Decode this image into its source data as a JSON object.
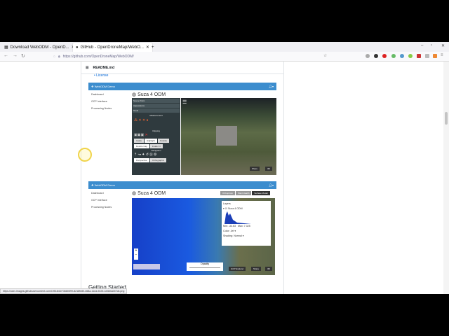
{
  "browser": {
    "tabs": [
      {
        "label": "Download WebODM - OpenD...",
        "active": false
      },
      {
        "label": "GitHub - OpenDroneMap/WebO...",
        "active": true
      }
    ],
    "new_tab": "+",
    "url": "https://github.com/OpenDroneMap/WebODM/",
    "status_url": "https://user-images.githubusercontent.com/1951843/73680599-8218fe80-468a-11ea-9225-443bba0b7c8.png"
  },
  "readme": {
    "file": "README.md",
    "license_link": "License",
    "heading": "Getting Started",
    "demo1": {
      "brand": "WebODM Demo",
      "title": "Suza 4 ODM",
      "sidebar": [
        "Dashboard",
        "GCP Interface",
        "Processing Nodes"
      ],
      "panel_sections": [
        "Measurement",
        "Clipping",
        "Navigation"
      ],
      "panel_rows": [
        "Scene Point",
        "Appearance",
        "Tools"
      ],
      "buttons": [
        "Inside",
        "Highlight",
        "Outside",
        "Double Cap",
        "Inside Cl",
        "Perspective",
        "Orthographic"
      ],
      "share": "Share",
      "view3d": "3D"
    },
    "demo2": {
      "brand": "WebODM Demo",
      "title": "Suza 4 ODM",
      "sidebar": [
        "Dashboard",
        "GCP Interface",
        "Processing Nodes"
      ],
      "actions": [
        "Orthophoto",
        "Plant Health",
        "Surface Model"
      ],
      "layers": {
        "title": "Layers",
        "item": "Suza 4 ODM",
        "min_label": "Min:",
        "min": "-33.63",
        "max_label": "Max:",
        "max": "7.325",
        "color_label": "Color:",
        "color": "Jet",
        "shading_label": "Shading:",
        "shading": "Normal"
      },
      "opacity": "Opacity",
      "gcp": "GCP Explorer",
      "share": "Share",
      "view3d": "3D"
    }
  }
}
